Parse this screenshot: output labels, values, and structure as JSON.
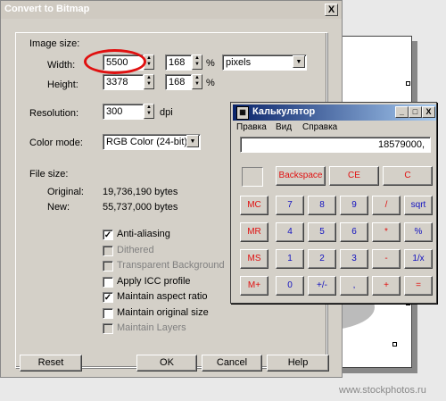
{
  "dialog": {
    "title": "Convert to Bitmap",
    "close": "X",
    "image_size_label": "Image size:",
    "width_label": "Width:",
    "width_value": "5500",
    "width_percent": "168",
    "height_label": "Height:",
    "height_value": "3378",
    "height_percent": "168",
    "percent_sign": "%",
    "units": "pixels",
    "resolution_label": "Resolution:",
    "resolution_value": "300",
    "resolution_unit": "dpi",
    "color_mode_label": "Color mode:",
    "color_mode_value": "RGB Color (24-bit)",
    "file_size_label": "File size:",
    "original_label": "Original:",
    "original_value": "19,736,190 bytes",
    "new_label": "New:",
    "new_value": "55,737,000 bytes",
    "options": [
      {
        "label": "Anti-aliasing",
        "checked": true,
        "enabled": true
      },
      {
        "label": "Dithered",
        "checked": false,
        "enabled": false
      },
      {
        "label": "Transparent Background",
        "checked": false,
        "enabled": false
      },
      {
        "label": "Apply ICC profile",
        "checked": false,
        "enabled": true
      },
      {
        "label": "Maintain aspect ratio",
        "checked": true,
        "enabled": true
      },
      {
        "label": "Maintain original size",
        "checked": false,
        "enabled": true
      },
      {
        "label": "Maintain Layers",
        "checked": false,
        "enabled": false
      }
    ],
    "buttons": {
      "reset": "Reset",
      "ok": "OK",
      "cancel": "Cancel",
      "help": "Help"
    }
  },
  "calculator": {
    "title": "Калькулятор",
    "title_icon": "calculator-icon",
    "window_buttons": {
      "minimize": "_",
      "maximize": "□",
      "close": "X"
    },
    "menu": [
      "Правка",
      "Вид",
      "Справка"
    ],
    "display": "18579000,",
    "top_keys": [
      "Backspace",
      "CE",
      "C"
    ],
    "memory_keys": [
      "MC",
      "MR",
      "MS",
      "M+"
    ],
    "rows": [
      [
        "7",
        "8",
        "9",
        "/",
        "sqrt"
      ],
      [
        "4",
        "5",
        "6",
        "*",
        "%"
      ],
      [
        "1",
        "2",
        "3",
        "-",
        "1/x"
      ],
      [
        "0",
        "+/-",
        ",",
        "+",
        "="
      ]
    ]
  },
  "watermark": "www.stockphotos.ru",
  "colors": {
    "highlight_circle": "#e01010",
    "calc_title": "#0a246a",
    "calc_red": "#e01010",
    "calc_blue": "#1010c0"
  }
}
